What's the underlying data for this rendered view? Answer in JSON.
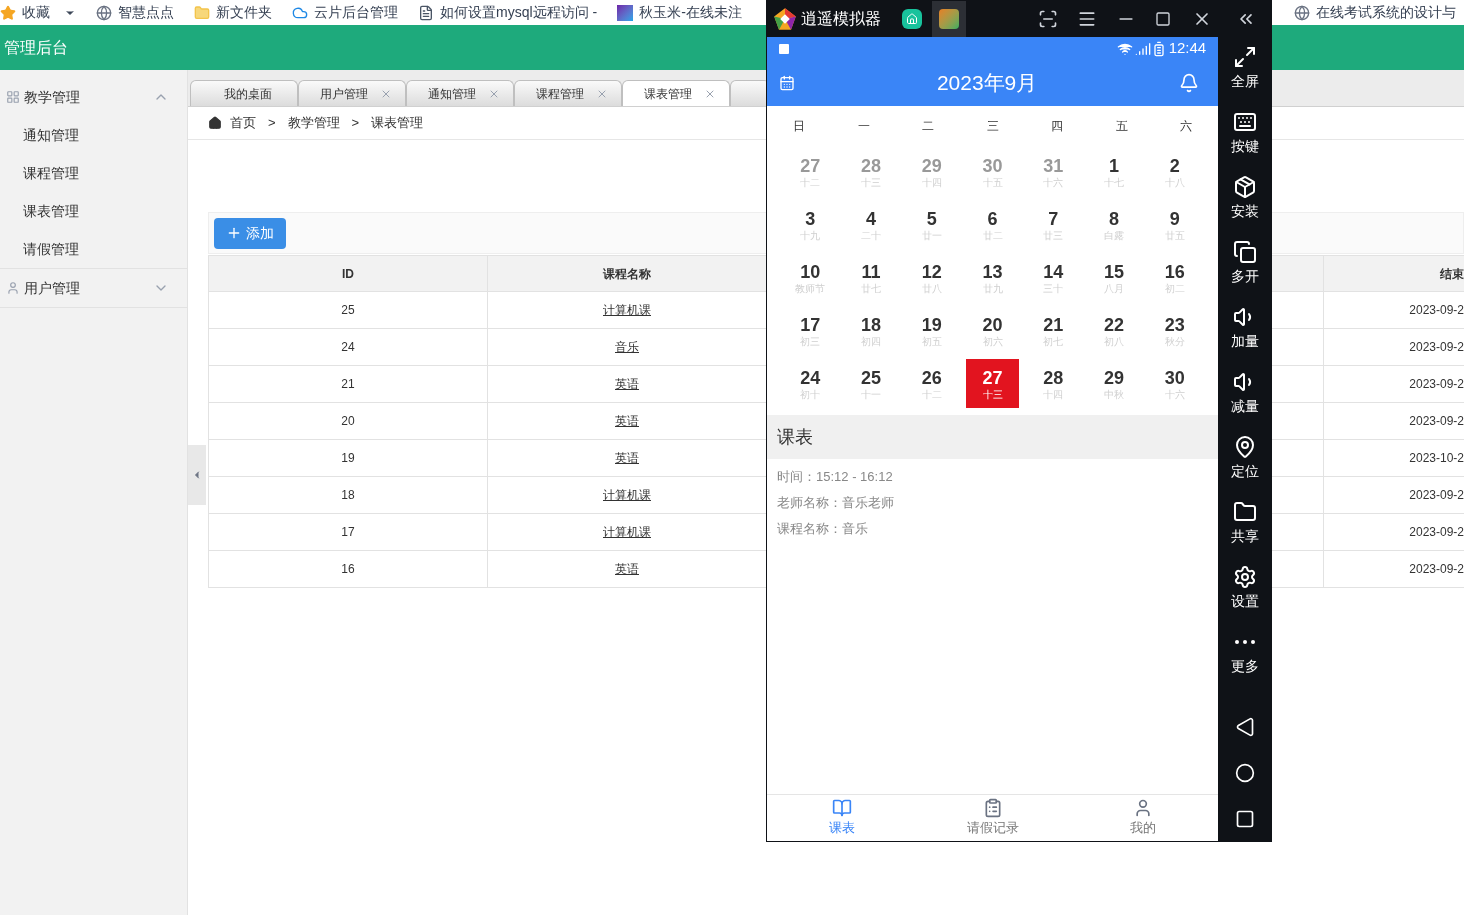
{
  "bookmarks": [
    {
      "label": "收藏",
      "kind": "star"
    },
    {
      "label": "智慧点点",
      "kind": "globe"
    },
    {
      "label": "新文件夹",
      "kind": "folder"
    },
    {
      "label": "云片后台管理",
      "kind": "cloud"
    },
    {
      "label": "如何设置mysql远程访问 -",
      "kind": "page"
    },
    {
      "label": "秋玉米-在线未注",
      "kind": "app"
    }
  ],
  "bookmark_right": {
    "label": "在线考试系统的设计与"
  },
  "header": {
    "title": "管理后台"
  },
  "sidebar": [
    {
      "label": "教学管理",
      "expanded": true,
      "children": [
        {
          "label": "通知管理"
        },
        {
          "label": "课程管理"
        },
        {
          "label": "课表管理"
        },
        {
          "label": "请假管理"
        }
      ]
    },
    {
      "label": "用户管理",
      "expanded": false
    }
  ],
  "tabs": [
    {
      "label": "我的桌面",
      "closable": false,
      "selected": false
    },
    {
      "label": "用户管理",
      "closable": true,
      "selected": false
    },
    {
      "label": "通知管理",
      "closable": true,
      "selected": false
    },
    {
      "label": "课程管理",
      "closable": true,
      "selected": false
    },
    {
      "label": "课表管理",
      "closable": true,
      "selected": true
    }
  ],
  "breadcrumb": [
    "首页",
    "教学管理",
    "课表管理"
  ],
  "breadcrumb_separator": ">",
  "add_button": "添加",
  "table": {
    "columns": [
      "ID",
      "课程名称",
      "结束"
    ],
    "rows": [
      [
        "25",
        "计算机课",
        "2023-09-2"
      ],
      [
        "24",
        "音乐",
        "2023-09-2"
      ],
      [
        "21",
        "英语",
        "2023-09-2"
      ],
      [
        "20",
        "英语",
        "2023-09-2"
      ],
      [
        "19",
        "英语",
        "2023-10-2"
      ],
      [
        "18",
        "计算机课",
        "2023-09-2"
      ],
      [
        "17",
        "计算机课",
        "2023-09-2"
      ],
      [
        "16",
        "英语",
        "2023-09-2"
      ]
    ]
  },
  "emulator": {
    "title": "逍遥模拟器",
    "toolbar": [
      {
        "label": "全屏",
        "kind": "fullscreen"
      },
      {
        "label": "按键",
        "kind": "keyboard"
      },
      {
        "label": "安装",
        "kind": "apk"
      },
      {
        "label": "多开",
        "kind": "multi"
      },
      {
        "label": "加量",
        "kind": "volume_up"
      },
      {
        "label": "减量",
        "kind": "volume_down"
      },
      {
        "label": "定位",
        "kind": "location"
      },
      {
        "label": "共享",
        "kind": "folder"
      },
      {
        "label": "设置",
        "kind": "settings"
      },
      {
        "label": "更多",
        "kind": "more"
      }
    ]
  },
  "phone": {
    "time": "12:44",
    "title": "2023年9月",
    "weekdays": [
      "日",
      "一",
      "二",
      "三",
      "四",
      "五",
      "六"
    ],
    "weeks": [
      [
        {
          "day": "27",
          "lunar": "十二",
          "muted": true,
          "selected": false
        },
        {
          "day": "28",
          "lunar": "十三",
          "muted": true,
          "selected": false
        },
        {
          "day": "29",
          "lunar": "十四",
          "muted": true,
          "selected": false
        },
        {
          "day": "30",
          "lunar": "十五",
          "muted": true,
          "selected": false
        },
        {
          "day": "31",
          "lunar": "十六",
          "muted": true,
          "selected": false
        },
        {
          "day": "1",
          "lunar": "十七",
          "muted": false,
          "selected": false
        },
        {
          "day": "2",
          "lunar": "十八",
          "muted": false,
          "selected": false
        }
      ],
      [
        {
          "day": "3",
          "lunar": "十九",
          "muted": false,
          "selected": false
        },
        {
          "day": "4",
          "lunar": "二十",
          "muted": false,
          "selected": false
        },
        {
          "day": "5",
          "lunar": "廿一",
          "muted": false,
          "selected": false
        },
        {
          "day": "6",
          "lunar": "廿二",
          "muted": false,
          "selected": false
        },
        {
          "day": "7",
          "lunar": "廿三",
          "muted": false,
          "selected": false
        },
        {
          "day": "8",
          "lunar": "白露",
          "muted": false,
          "selected": false
        },
        {
          "day": "9",
          "lunar": "廿五",
          "muted": false,
          "selected": false
        }
      ],
      [
        {
          "day": "10",
          "lunar": "教师节",
          "muted": false,
          "selected": false
        },
        {
          "day": "11",
          "lunar": "廿七",
          "muted": false,
          "selected": false
        },
        {
          "day": "12",
          "lunar": "廿八",
          "muted": false,
          "selected": false
        },
        {
          "day": "13",
          "lunar": "廿九",
          "muted": false,
          "selected": false
        },
        {
          "day": "14",
          "lunar": "三十",
          "muted": false,
          "selected": false
        },
        {
          "day": "15",
          "lunar": "八月",
          "muted": false,
          "selected": false
        },
        {
          "day": "16",
          "lunar": "初二",
          "muted": false,
          "selected": false
        }
      ],
      [
        {
          "day": "17",
          "lunar": "初三",
          "muted": false,
          "selected": false
        },
        {
          "day": "18",
          "lunar": "初四",
          "muted": false,
          "selected": false
        },
        {
          "day": "19",
          "lunar": "初五",
          "muted": false,
          "selected": false
        },
        {
          "day": "20",
          "lunar": "初六",
          "muted": false,
          "selected": false
        },
        {
          "day": "21",
          "lunar": "初七",
          "muted": false,
          "selected": false
        },
        {
          "day": "22",
          "lunar": "初八",
          "muted": false,
          "selected": false
        },
        {
          "day": "23",
          "lunar": "秋分",
          "muted": false,
          "selected": false
        }
      ],
      [
        {
          "day": "24",
          "lunar": "初十",
          "muted": false,
          "selected": false
        },
        {
          "day": "25",
          "lunar": "十一",
          "muted": false,
          "selected": false
        },
        {
          "day": "26",
          "lunar": "十二",
          "muted": false,
          "selected": false
        },
        {
          "day": "27",
          "lunar": "十三",
          "muted": false,
          "selected": true
        },
        {
          "day": "28",
          "lunar": "十四",
          "muted": false,
          "selected": false
        },
        {
          "day": "29",
          "lunar": "中秋",
          "muted": false,
          "selected": false
        },
        {
          "day": "30",
          "lunar": "十六",
          "muted": false,
          "selected": false
        }
      ]
    ],
    "section_title": "课表",
    "details": [
      "时间：15:12 - 16:12",
      "老师名称：音乐老师",
      "课程名称：音乐"
    ],
    "nav": [
      {
        "label": "课表",
        "kind": "schedule",
        "selected": true
      },
      {
        "label": "请假记录",
        "kind": "records",
        "selected": false
      },
      {
        "label": "我的",
        "kind": "profile",
        "selected": false
      }
    ]
  }
}
